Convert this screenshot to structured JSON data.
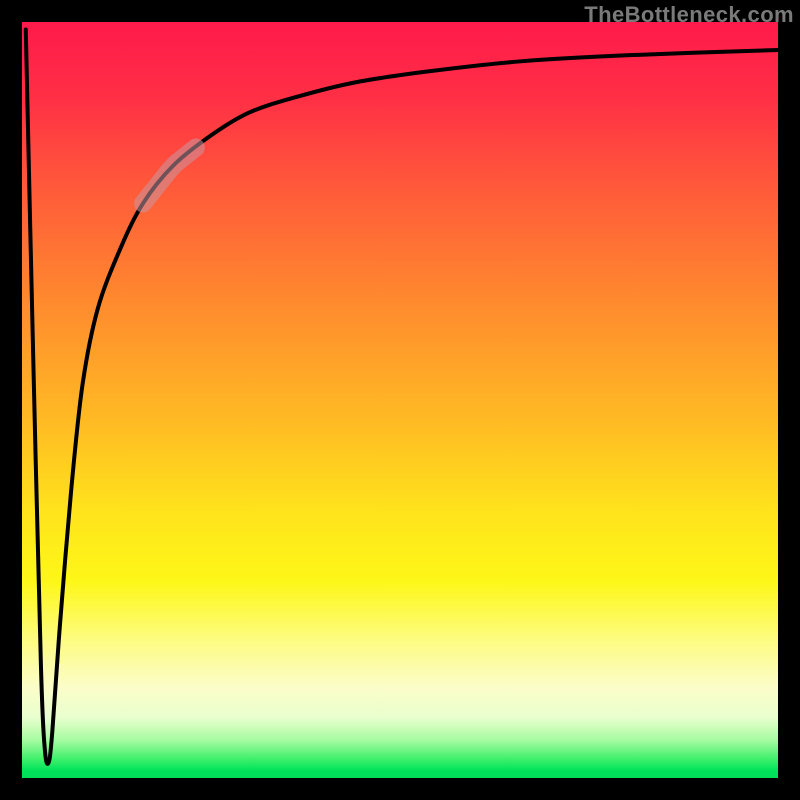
{
  "watermark": "TheBottleneck.com",
  "colors": {
    "frame": "#000000",
    "curve": "#000000",
    "highlight": "rgba(200,150,160,0.55)"
  },
  "chart_data": {
    "type": "line",
    "title": "",
    "xlabel": "",
    "ylabel": "",
    "xlim": [
      0,
      100
    ],
    "ylim": [
      0,
      100
    ],
    "grid": false,
    "legend": false,
    "annotations": [
      {
        "kind": "highlight-segment",
        "x_range": [
          16,
          23
        ],
        "note": "pale highlighted band on rising curve"
      }
    ],
    "series": [
      {
        "name": "bottleneck-curve",
        "x": [
          0.5,
          1.5,
          2.5,
          3.0,
          3.5,
          4.0,
          5.0,
          6.5,
          8.0,
          10,
          13,
          16,
          20,
          25,
          30,
          36,
          44,
          54,
          66,
          80,
          100
        ],
        "y": [
          99,
          55,
          15,
          4,
          2,
          6,
          20,
          38,
          52,
          62,
          70,
          76,
          81,
          85,
          88,
          90,
          92,
          93.5,
          94.8,
          95.6,
          96.3
        ]
      }
    ]
  }
}
